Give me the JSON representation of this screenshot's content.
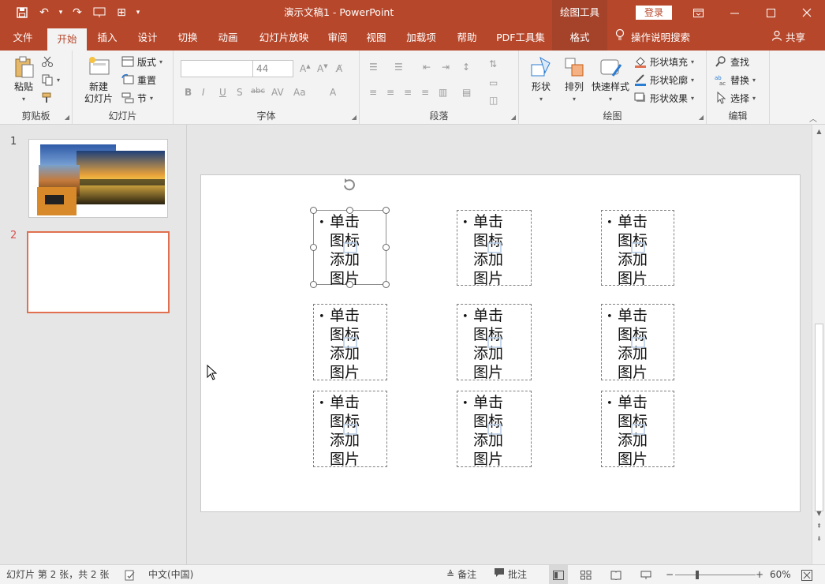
{
  "titlebar": {
    "doc_title": "演示文稿1  -  PowerPoint",
    "context_tab": "绘图工具",
    "login": "登录"
  },
  "tabs": [
    "文件",
    "开始",
    "插入",
    "设计",
    "切换",
    "动画",
    "幻灯片放映",
    "审阅",
    "视图",
    "加载项",
    "帮助",
    "PDF工具集",
    "格式"
  ],
  "active_tab": "开始",
  "tell_me": "操作说明搜索",
  "share": "共享",
  "ribbon": {
    "clipboard": {
      "paste": "粘贴",
      "label": "剪贴板"
    },
    "slides": {
      "new_slide_line1": "新建",
      "new_slide_line2": "幻灯片",
      "layout": "版式",
      "reset": "重置",
      "section": "节",
      "label": "幻灯片"
    },
    "font": {
      "font_name": "",
      "font_size": "44",
      "label": "字体"
    },
    "paragraph": {
      "label": "段落"
    },
    "drawing": {
      "shapes": "形状",
      "arrange": "排列",
      "quick_styles": "快速样式",
      "fill": "形状填充",
      "outline": "形状轮廓",
      "effects": "形状效果",
      "label": "绘图"
    },
    "editing": {
      "find": "查找",
      "replace": "替换",
      "select": "选择",
      "label": "编辑"
    }
  },
  "slides": [
    {
      "number": "1"
    },
    {
      "number": "2"
    }
  ],
  "placeholder_text": "单击图标添加图片",
  "placeholder_bullet": "•",
  "statusbar": {
    "slide_info": "幻灯片 第 2 张，共 2 张",
    "language": "中文(中国)",
    "notes": "备注",
    "comments": "批注",
    "zoom": "60%"
  },
  "colors": {
    "accent": "#b7472a",
    "selected_thumb_border": "#e0704f"
  }
}
